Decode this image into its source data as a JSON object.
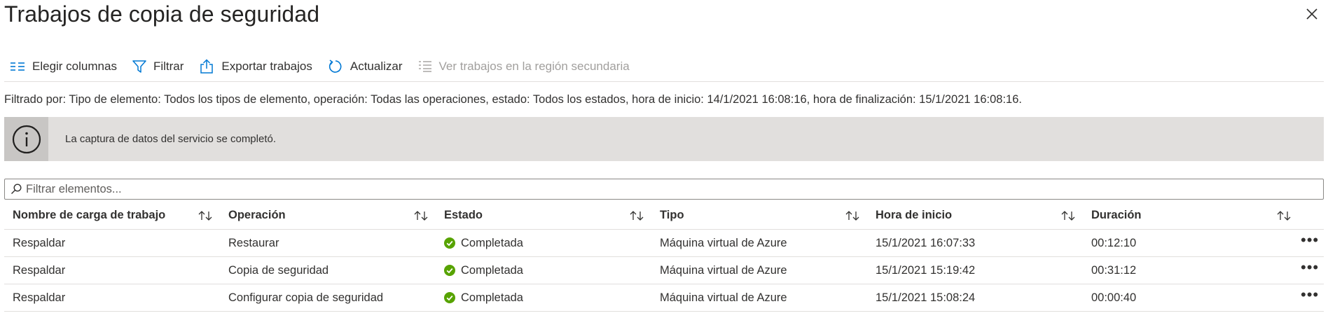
{
  "header": {
    "title": "Trabajos de copia de seguridad",
    "close_icon": "close-icon"
  },
  "toolbar": {
    "choose_columns": "Elegir columnas",
    "filter": "Filtrar",
    "export": "Exportar trabajos",
    "refresh": "Actualizar",
    "secondary_region": "Ver trabajos en la región secundaria"
  },
  "filter_summary": "Filtrado por: Tipo de elemento: Todos los tipos de elemento, operación: Todas las operaciones, estado: Todos los estados, hora de inicio: 14/1/2021 16:08:16, hora de finalización: 15/1/2021 16:08:16.",
  "info_bar": {
    "message": "La captura de datos del servicio se completó.",
    "icon": "info-icon"
  },
  "search": {
    "placeholder": "Filtrar elementos..."
  },
  "table": {
    "columns": [
      "Nombre de carga de trabajo",
      "Operación",
      "Estado",
      "Tipo",
      "Hora de inicio",
      "Duración"
    ],
    "rows": [
      [
        "Respaldar",
        "Restaurar",
        "Completada",
        "Máquina virtual de Azure",
        "15/1/2021 16:07:33",
        "00:12:10"
      ],
      [
        "Respaldar",
        "Copia de seguridad",
        "Completada",
        "Máquina virtual de Azure",
        "15/1/2021 15:19:42",
        "00:31:12"
      ],
      [
        "Respaldar",
        "Configurar copia de seguridad",
        "Completada",
        "Máquina virtual de Azure",
        "15/1/2021 15:08:24",
        "00:00:40"
      ]
    ],
    "more_label": "•••"
  },
  "colors": {
    "accent": "#0078d4",
    "success": "#57a300",
    "info_bar_bg": "#e1dfdd",
    "info_icon_bg": "#c8c6c4"
  }
}
